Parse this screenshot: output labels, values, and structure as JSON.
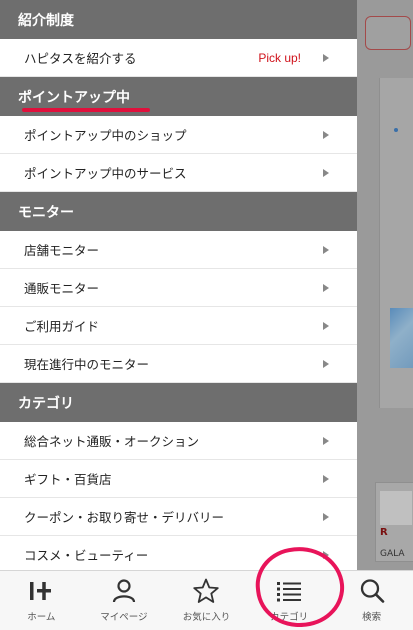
{
  "sections": [
    {
      "title": "紹介制度",
      "items": [
        {
          "label": "ハピタスを紹介する",
          "badge": "Pick up!"
        }
      ]
    },
    {
      "title": "ポイントアップ中",
      "items": [
        {
          "label": "ポイントアップ中のショップ"
        },
        {
          "label": "ポイントアップ中のサービス"
        }
      ]
    },
    {
      "title": "モニター",
      "items": [
        {
          "label": "店舗モニター"
        },
        {
          "label": "通販モニター"
        },
        {
          "label": "ご利用ガイド"
        },
        {
          "label": "現在進行中のモニター"
        }
      ]
    },
    {
      "title": "カテゴリ",
      "items": [
        {
          "label": "総合ネット通販・オークション"
        },
        {
          "label": "ギフト・百貨店"
        },
        {
          "label": "クーポン・お取り寄せ・デリバリー"
        },
        {
          "label": "コスメ・ビューティー"
        }
      ]
    }
  ],
  "bottom_nav": [
    {
      "label": "ホーム",
      "icon": "home-icon"
    },
    {
      "label": "マイページ",
      "icon": "person-icon"
    },
    {
      "label": "お気に入り",
      "icon": "star-icon"
    },
    {
      "label": "カテゴリ",
      "icon": "list-icon"
    },
    {
      "label": "検索",
      "icon": "search-icon"
    }
  ],
  "background_peek": {
    "thumb_mark": "R",
    "thumb_text": "GALA"
  },
  "colors": {
    "header_bg": "#6e6e6e",
    "pickup": "#d0121b",
    "annotation": "#e0103c"
  }
}
